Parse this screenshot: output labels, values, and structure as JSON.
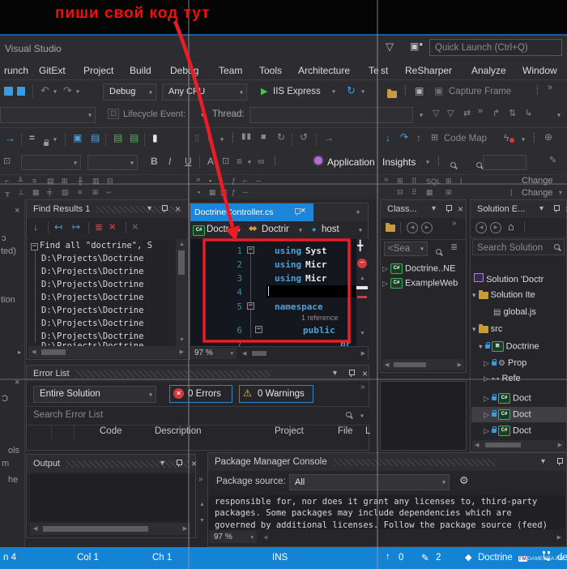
{
  "annotation": {
    "label": "пиши свой код тут"
  },
  "titlebar": {
    "title": "Visual Studio",
    "quick_launch": "Quick Launch (Ctrl+Q)"
  },
  "menu": {
    "items": [
      "runch",
      "GitExt",
      "Project",
      "Build",
      "Debug",
      "Team",
      "Tools",
      "Architecture",
      "Te",
      "st",
      "ReSharper",
      "Analyze",
      "Window"
    ]
  },
  "toolbar1": {
    "config": "Debug",
    "platform": "Any CPU",
    "run": "IIS Express",
    "capture": "Capture Frame"
  },
  "toolbar2": {
    "lifecycle": "Lifecycle Event:",
    "thread": "Thread:"
  },
  "toolbar3": {
    "codemap": "Code Map"
  },
  "toolbar4": {
    "b": "B",
    "i": "I",
    "u": "U",
    "ai1": "Application",
    "ai2": "Insights"
  },
  "toolbar5": {
    "sql": "SQL",
    "change1": "Change",
    "change2": "Change"
  },
  "find": {
    "title": "Find Results 1",
    "summary": "Find all \"doctrine\", S",
    "line": "D:\\Projects\\Doctrine"
  },
  "editor": {
    "tab": "DoctrineController.cs",
    "bc1": "Doctr",
    "bc2": "Doctrir",
    "bc3": "host",
    "zoom": "97 %",
    "n1": "1",
    "n2": "2",
    "n3": "3",
    "n4": "4",
    "n5": "5",
    "n6": "6",
    "n7": "7",
    "k_using": "using",
    "id1": "Syst",
    "id2": "Micr",
    "id3": "Micr",
    "k_namespace": "namespace",
    "codelens": "1 reference",
    "k_public": "public",
    "l7": "pr"
  },
  "class_view": {
    "title": "Class...",
    "search": "<Sea",
    "item1": "Doctrine..NE",
    "item2": "ExampleWeb"
  },
  "solution": {
    "title": "Solution E...",
    "search": "Search Solution",
    "root": "Solution 'Doctr",
    "items_folder": "Solution Ite",
    "global_json": "global.js",
    "src": "src",
    "project": "Doctrine",
    "properties": "Prop",
    "references": "Refe",
    "file": "Doct"
  },
  "errors": {
    "title": "Error List",
    "scope": "Entire Solution",
    "errors": "0 Errors",
    "warnings": "0 Warnings",
    "search": "Search Error List",
    "col_code": "Code",
    "col_desc": "Description",
    "col_project": "Project",
    "col_file": "File",
    "col_line": "L"
  },
  "output": {
    "title": "Output"
  },
  "pmc": {
    "title": "Package Manager Console",
    "source_label": "Package source:",
    "source": "All",
    "zoom": "97 %",
    "line1": "responsible for, nor does it grant any licenses to, third-party",
    "line2": "packages. Some packages may include dependencies which are",
    "line3": "governed by additional licenses. Follow the package source (feed)"
  },
  "status": {
    "ln": "n 4",
    "col": "Col 1",
    "ch": "Ch 1",
    "mode": "INS",
    "pull": "0",
    "edits": "2",
    "repo": "Doctrine",
    "branch": "de",
    "watermark": "GAMEI3BA.RU"
  },
  "edge": {
    "f1": "×",
    "f2": "ɔ",
    "f3": "ted)",
    "f4": "tion",
    "f5": "×",
    "f6": "Ɔ",
    "f7": "ols",
    "f8": "m",
    "f9": "he"
  },
  "colors": {
    "status_blue": "#1583d3",
    "tab_blue": "#1b86d9",
    "annotation_red": "#ec1c24",
    "keyword_blue": "#4ba3dd"
  }
}
